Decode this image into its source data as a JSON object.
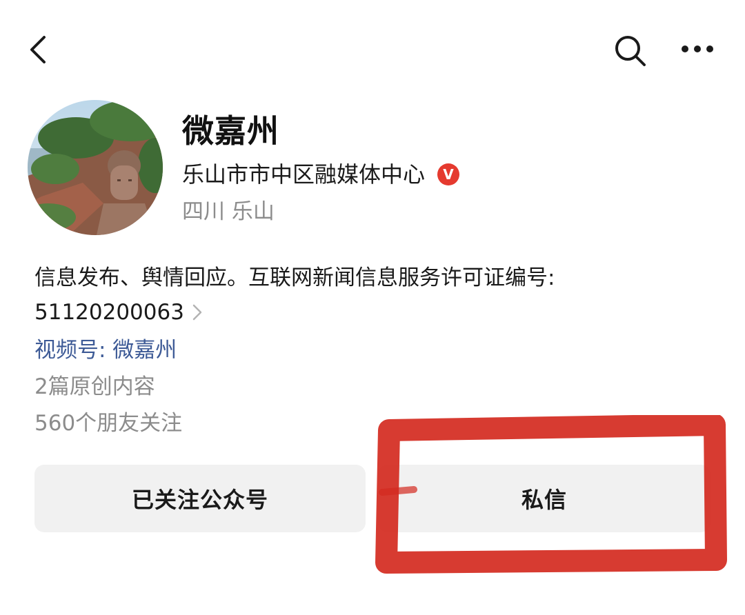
{
  "account": {
    "name": "微嘉州",
    "organization": "乐山市市中区融媒体中心",
    "verified_badge": "V",
    "location": "四川 乐山"
  },
  "profile": {
    "description": "信息发布、舆情回应。互联网新闻信息服务许可证编号:",
    "license_number": "51120200063",
    "channel_link": "视频号: 微嘉州",
    "original_content": "2篇原创内容",
    "followers": "560个朋友关注"
  },
  "actions": {
    "follow_label": "已关注公众号",
    "message_label": "私信"
  },
  "icons": {
    "back": "back-arrow-icon",
    "search": "search-icon",
    "more": "more-dots-icon",
    "chevron": "chevron-right-icon"
  },
  "colors": {
    "verified_badge": "#e53a2f",
    "link": "#3d5a96",
    "secondary_text": "#8c8c8c",
    "button_background": "#f1f1f1",
    "highlight": "#d42a20"
  }
}
